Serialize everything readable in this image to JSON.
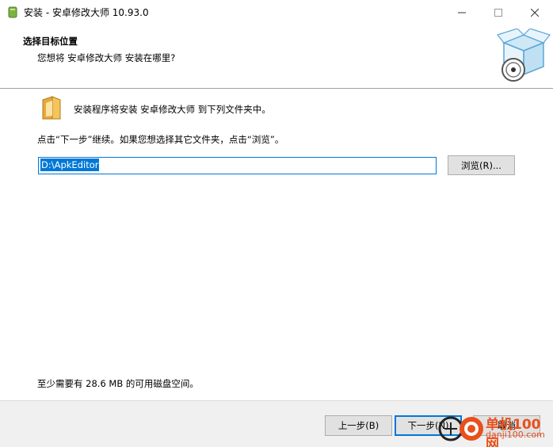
{
  "window": {
    "title": "安装 - 安卓修改大师 10.93.0",
    "minimize_symbol": "—",
    "maximize_symbol": "☐",
    "close_symbol": "✕"
  },
  "header": {
    "title": "选择目标位置",
    "subtitle": "您想将 安卓修改大师 安装在哪里?",
    "logo_icon": "installer-box-icon"
  },
  "body": {
    "install_message": "安装程序将安装 安卓修改大师 到下列文件夹中。",
    "instruction": "点击“下一步”继续。如果您想选择其它文件夹，点击“浏览”。",
    "path_value": "D:\\ApkEditor",
    "browse_label": "浏览(R)...",
    "space_required": "至少需要有 28.6 MB 的可用磁盘空间。"
  },
  "footer": {
    "back_label": "上一步(B)",
    "next_label": "下一步(N)",
    "cancel_label": "取消"
  },
  "watermark": {
    "line1": "单机100网",
    "line2": "danji100.com"
  },
  "colors": {
    "accent": "#0078d7",
    "footer_bg": "#f0f0f0",
    "button_bg": "#e1e1e1",
    "watermark": "#e8501c"
  }
}
